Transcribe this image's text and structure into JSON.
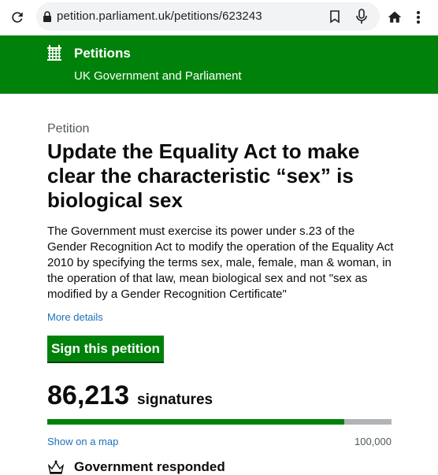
{
  "browser": {
    "url": "petition.parliament.uk/petitions/623243"
  },
  "header": {
    "title": "Petitions",
    "subtitle": "UK Government and Parliament"
  },
  "petition": {
    "caption": "Petition",
    "title": "Update the Equality Act to make clear the characteristic “sex” is biological sex",
    "body": "The Government must exercise its power under s.23 of the Gender Recognition Act to modify the operation of the Equality Act 2010 by specifying the terms sex, male, female, man & woman, in the operation of that law, mean biological sex and not \"sex as modified by a Gender Recognition Certificate\"",
    "more_details": "More details",
    "sign_button": "Sign this petition",
    "signature_count": "86,213",
    "signatures_label": "signatures",
    "progress_fraction": 0.862,
    "map_link": "Show on a map",
    "goal": "100,000",
    "response_status": "Government responded"
  },
  "colors": {
    "brand_green": "#00820a",
    "link_blue": "#1d70b8"
  },
  "icons": [
    "reload-icon",
    "lock-icon",
    "bookmark-icon",
    "mic-icon",
    "home-icon",
    "more-vert-icon",
    "portcullis-icon",
    "crown-icon"
  ]
}
